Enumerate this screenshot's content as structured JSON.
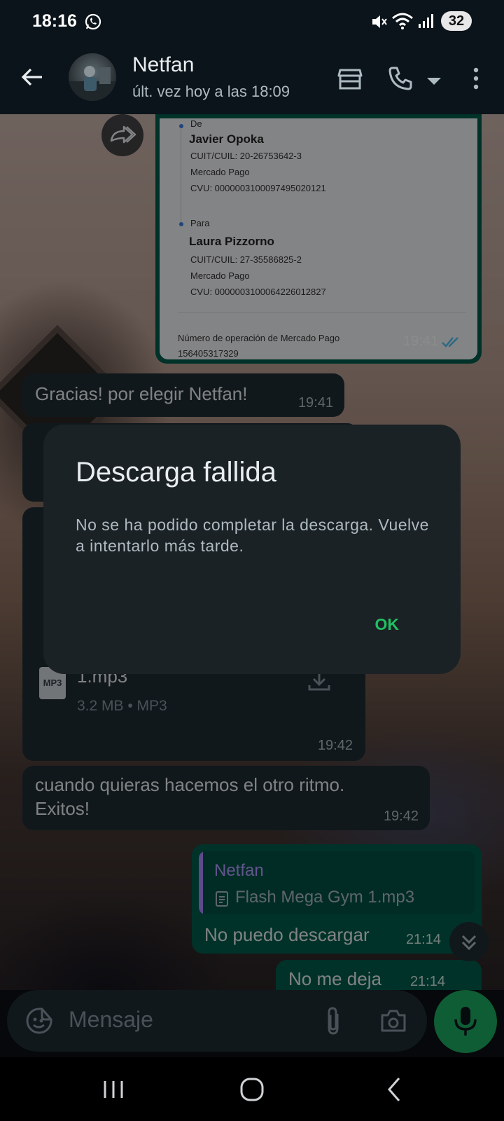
{
  "status_bar": {
    "time": "18:16",
    "battery": "32"
  },
  "header": {
    "contact_name": "Netfan",
    "contact_status": "últ. vez hoy a las 18:09"
  },
  "receipt_image": {
    "from_label": "De",
    "from_name": "Javier Opoka",
    "from_cuit": "CUIT/CUIL: 20-26753642-3",
    "from_bank": "Mercado Pago",
    "from_cvu": "CVU: 0000003100097495020121",
    "to_label": "Para",
    "to_name": "Laura Pizzorno",
    "to_cuit": "CUIT/CUIL: 27-35586825-2",
    "to_bank": "Mercado Pago",
    "to_cvu": "CVU: 0000003100064226012827",
    "operation_label": "Número de operación de Mercado Pago",
    "operation_number": "156405317329",
    "time": "19:41"
  },
  "messages": [
    {
      "text": "Gracias! por elegir Netfan!",
      "time": "19:41"
    },
    {
      "file_name": "1.mp3",
      "file_meta": "3.2 MB • MP3",
      "file_type": "MP3",
      "time": "19:42"
    },
    {
      "text": "cuando quieras hacemos el otro ritmo. Exitos!",
      "time": "19:42"
    },
    {
      "quote_name": "Netfan",
      "quote_file": "Flash Mega Gym 1.mp3",
      "text": "No puedo descargar",
      "time": "21:14"
    },
    {
      "text": "No me deja",
      "time": "21:14"
    }
  ],
  "dialog": {
    "title": "Descarga fallida",
    "body": "No se ha podido completar la descarga. Vuelve a intentarlo más tarde.",
    "ok": "OK"
  },
  "input": {
    "placeholder": "Mensaje"
  },
  "colors": {
    "accent": "#21c063",
    "outgoing": "#005c4b",
    "incoming": "#202c33"
  }
}
